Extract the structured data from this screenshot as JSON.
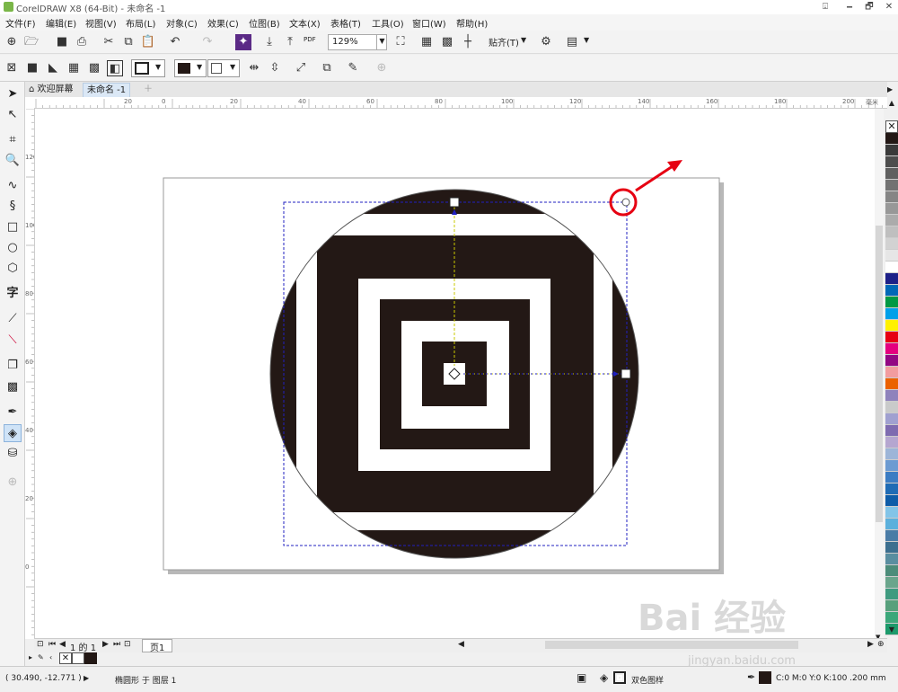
{
  "app": {
    "title": "CorelDRAW X8 (64-Bit) - 未命名 -1",
    "window_buttons": [
      "🗕",
      "🗗",
      "✕"
    ]
  },
  "menu": [
    "文件(F)",
    "编辑(E)",
    "视图(V)",
    "布局(L)",
    "对象(C)",
    "效果(C)",
    "位图(B)",
    "文本(X)",
    "表格(T)",
    "工具(O)",
    "窗口(W)",
    "帮助(H)"
  ],
  "toolbar": {
    "zoom": "129%",
    "snap_label": "贴齐(T)",
    "pdf_label": "PDF"
  },
  "tabs": {
    "welcome": "欢迎屏幕",
    "document": "未命名 -1"
  },
  "rulers": {
    "h_labels": [
      "20",
      "0",
      "20",
      "40",
      "60",
      "80",
      "100",
      "120",
      "140",
      "160",
      "180",
      "200"
    ],
    "unit": "毫米",
    "v_labels": [
      "120",
      "100",
      "80",
      "60",
      "40",
      "20",
      "0"
    ]
  },
  "pagebar": {
    "page_count": "1 的 1",
    "page_tab": "页1"
  },
  "status": {
    "coords": "( 30.490, -12.771 )",
    "object_info": "椭圆形 于 图层 1",
    "fill_label": "双色图样",
    "outline_info": "C:0 M:0 Y:0 K:100 .200 mm"
  },
  "palette_colors": [
    "#231815",
    "#3a3a3a",
    "#4d4d4d",
    "#5f5f5f",
    "#727272",
    "#858585",
    "#989898",
    "#ababab",
    "#bfbfbf",
    "#d2d2d2",
    "#e6e6e6",
    "#ffffff",
    "#1d2088",
    "#0068b7",
    "#009944",
    "#00a0e9",
    "#fff100",
    "#e60012",
    "#e4007f",
    "#920783",
    "#f29c9f",
    "#eb6100",
    "#8f82bc",
    "#c9caca",
    "#a0a0d0",
    "#7e6bb0",
    "#b5a6d0",
    "#9db5d8",
    "#6c9bd2",
    "#3b7cc3",
    "#1f6bb5",
    "#0e5ca8",
    "#82c4e8",
    "#5cb0dc",
    "#4a7ca6",
    "#3d6f8f",
    "#5a8ea0",
    "#4c8c7a",
    "#6aa58c",
    "#3f9b80",
    "#57a07c",
    "#3ba77a",
    "#1c9a6b"
  ],
  "watermark": "Bai 经验",
  "watermark_url": "jingyan.baidu.com"
}
